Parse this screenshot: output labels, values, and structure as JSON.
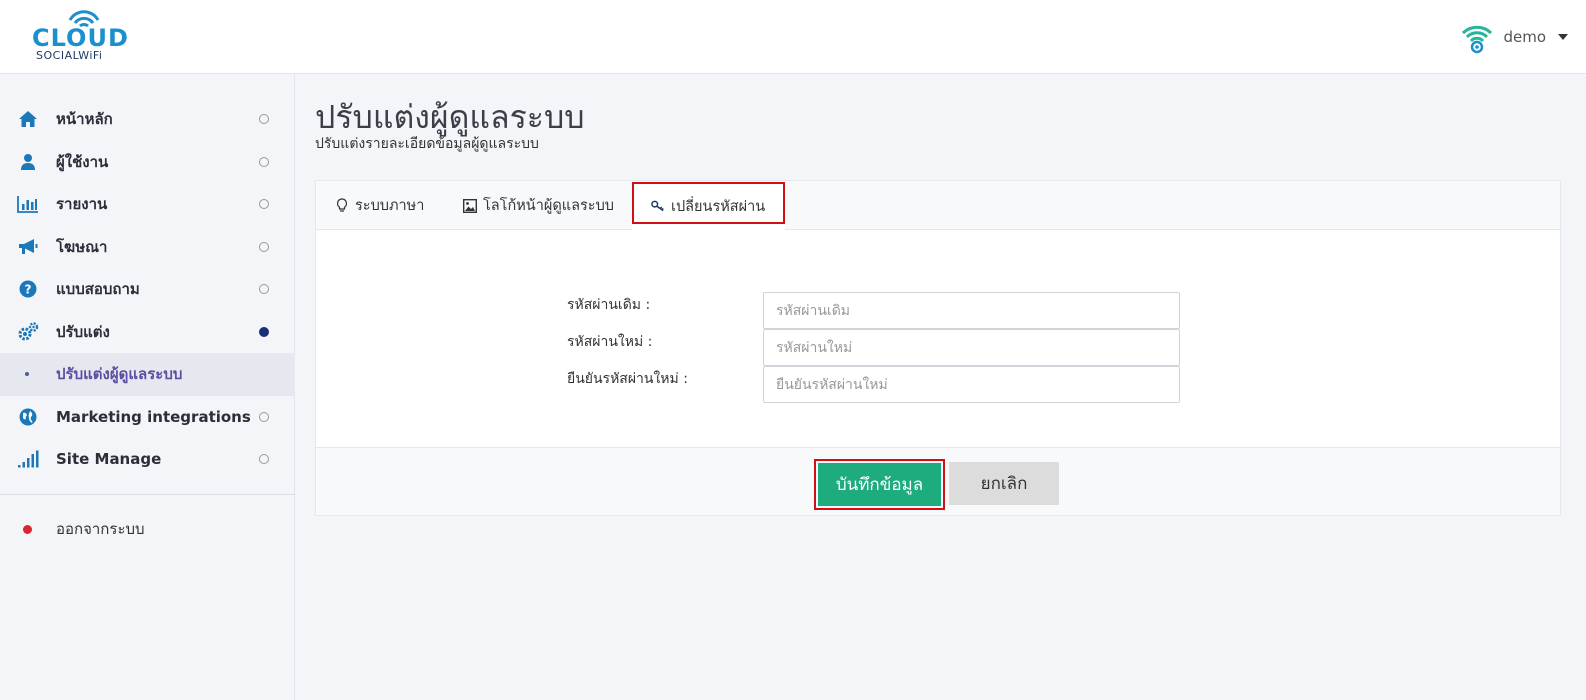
{
  "header": {
    "logo_top": "CLOUD",
    "logo_bottom": "SOCIALWiFi",
    "user_name": "demo"
  },
  "sidebar": {
    "items": [
      {
        "label": "หน้าหลัก",
        "icon": "home-icon"
      },
      {
        "label": "ผู้ใช้งาน",
        "icon": "user-icon"
      },
      {
        "label": "รายงาน",
        "icon": "bar-chart-icon"
      },
      {
        "label": "โฆษณา",
        "icon": "megaphone-icon"
      },
      {
        "label": "แบบสอบถาม",
        "icon": "question-icon"
      },
      {
        "label": "ปรับแต่ง",
        "icon": "gears-icon"
      },
      {
        "label": "ปรับแต่งผู้ดูแลระบบ",
        "icon": "bullet-icon"
      },
      {
        "label": "Marketing integrations",
        "icon": "globe-icon"
      },
      {
        "label": "Site Manage",
        "icon": "signal-icon"
      }
    ],
    "logout_label": "ออกจากระบบ"
  },
  "page": {
    "title": "ปรับแต่งผู้ดูแลระบบ",
    "subtitle": "ปรับแต่งรายละเอียดข้อมูลผู้ดูแลระบบ"
  },
  "tabs": [
    {
      "label": "ระบบภาษา",
      "icon": "lightbulb-icon"
    },
    {
      "label": "โลโก้หน้าผู้ดูแลระบบ",
      "icon": "image-icon"
    },
    {
      "label": "เปลี่ยนรหัสผ่าน",
      "icon": "key-icon"
    }
  ],
  "form": {
    "old_password_label": "รหัสผ่านเดิม :",
    "old_password_placeholder": "รหัสผ่านเดิม",
    "new_password_label": "รหัสผ่านใหม่ :",
    "new_password_placeholder": "รหัสผ่านใหม่",
    "confirm_password_label": "ยืนยันรหัสผ่านใหม่ :",
    "confirm_password_placeholder": "ยืนยันรหัสผ่านใหม่"
  },
  "footer": {
    "save_label": "บันทึกข้อมูล",
    "cancel_label": "ยกเลิก"
  },
  "colors": {
    "brand_blue": "#1c8fcf",
    "save_green": "#1eac7f",
    "highlight_red": "#d10f14",
    "active_dot": "#1a2f7a"
  }
}
